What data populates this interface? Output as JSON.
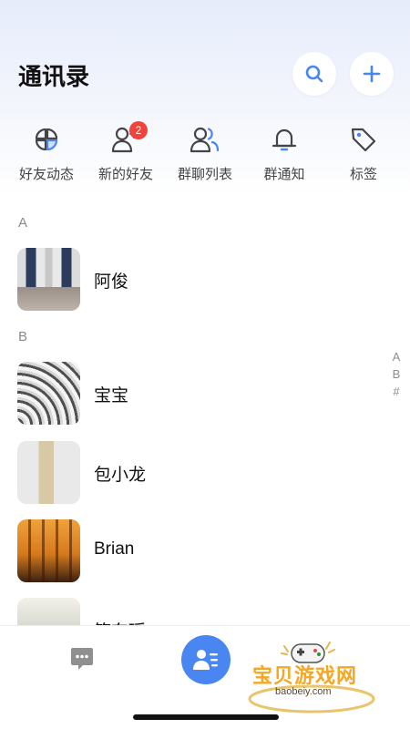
{
  "header": {
    "title": "通讯录",
    "search_icon": "search-icon",
    "add_icon": "plus-icon"
  },
  "quick_actions": [
    {
      "label": "好友动态",
      "icon": "moments-icon"
    },
    {
      "label": "新的好友",
      "icon": "add-friend-icon",
      "badge": "2"
    },
    {
      "label": "群聊列表",
      "icon": "group-chat-icon"
    },
    {
      "label": "群通知",
      "icon": "bell-icon"
    },
    {
      "label": "标签",
      "icon": "tag-icon"
    }
  ],
  "sections": [
    {
      "letter": "A",
      "contacts": [
        {
          "name": "阿俊"
        }
      ]
    },
    {
      "letter": "B",
      "contacts": [
        {
          "name": "宝宝"
        },
        {
          "name": "包小龙"
        },
        {
          "name": "Brian"
        },
        {
          "name": "笛东瑶"
        }
      ]
    }
  ],
  "index_bar": [
    "A",
    "B",
    "#"
  ],
  "bottom_nav": {
    "items": [
      {
        "name": "messages",
        "icon": "chat-bubble-icon",
        "active": false
      },
      {
        "name": "contacts",
        "icon": "contacts-icon",
        "active": true
      }
    ]
  },
  "watermark": {
    "title": "宝贝游戏网",
    "url": "baobeiy.com"
  },
  "colors": {
    "accent": "#4a86f2",
    "badge": "#f0443b",
    "text": "#111111",
    "secondary": "#8a8a8a"
  }
}
